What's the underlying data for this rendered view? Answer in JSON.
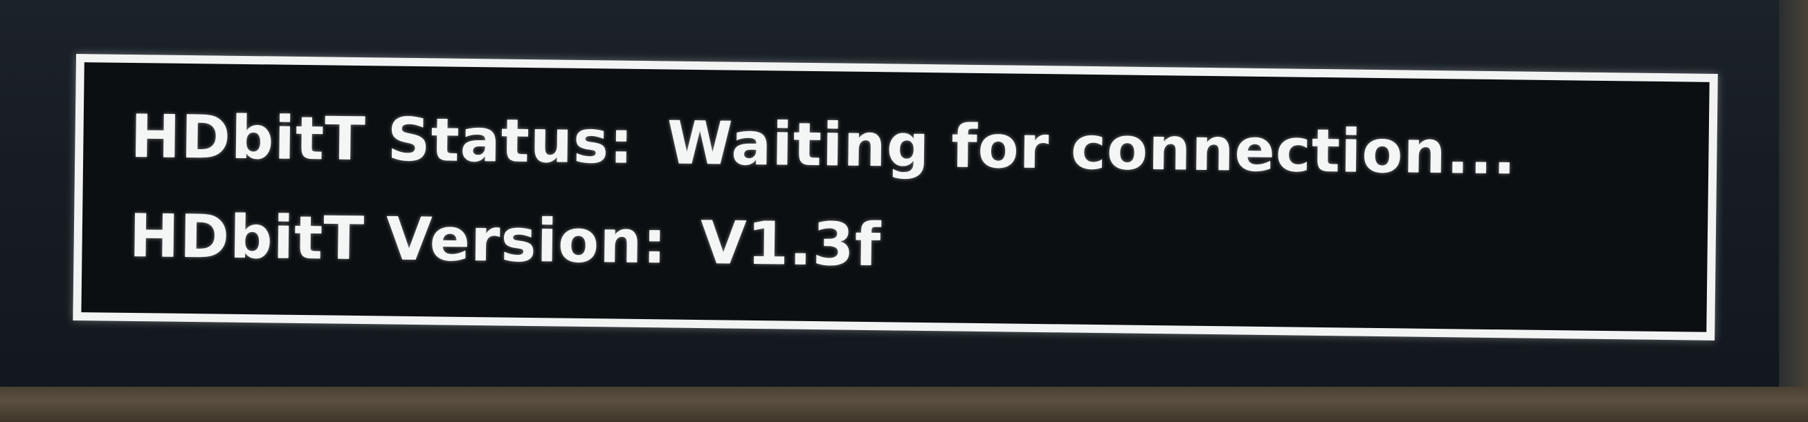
{
  "osd": {
    "status_label": "HDbitT Status:",
    "status_value": "Waiting for connection...",
    "version_label": "HDbitT Version:",
    "version_value": "V1.3f"
  }
}
